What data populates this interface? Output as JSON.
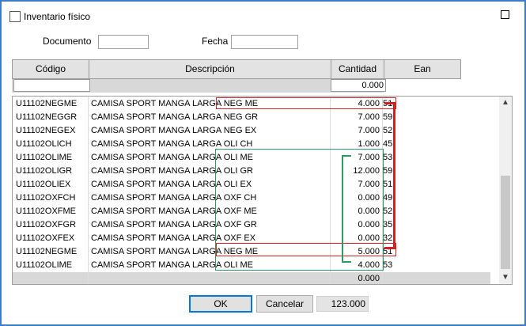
{
  "window": {
    "title": "Inventario físico"
  },
  "form": {
    "documento_label": "Documento",
    "documento_value": "",
    "fecha_label": "Fecha",
    "fecha_value": ""
  },
  "grid": {
    "headers": {
      "codigo": "Código",
      "descripcion": "Descripción",
      "cantidad": "Cantidad",
      "ean": "Ean"
    },
    "filter": {
      "codigo": "",
      "cantidad": "0.000"
    },
    "rows": [
      {
        "codigo": "U11102NEGME",
        "descripcion": "CAMISA SPORT MANGA LARGA NEG ME",
        "cantidad": "4.000",
        "ean": "51"
      },
      {
        "codigo": "U11102NEGGR",
        "descripcion": "CAMISA SPORT MANGA LARGA NEG GR",
        "cantidad": "7.000",
        "ean": "59"
      },
      {
        "codigo": "U11102NEGEX",
        "descripcion": "CAMISA SPORT MANGA LARGA NEG EX",
        "cantidad": "7.000",
        "ean": "52"
      },
      {
        "codigo": "U11102OLICH",
        "descripcion": "CAMISA SPORT MANGA LARGA OLI CH",
        "cantidad": "1.000",
        "ean": "45"
      },
      {
        "codigo": "U11102OLIME",
        "descripcion": "CAMISA SPORT MANGA LARGA OLI ME",
        "cantidad": "7.000",
        "ean": "53"
      },
      {
        "codigo": "U11102OLIGR",
        "descripcion": "CAMISA SPORT MANGA LARGA OLI GR",
        "cantidad": "12.000",
        "ean": "59"
      },
      {
        "codigo": "U11102OLIEX",
        "descripcion": "CAMISA SPORT MANGA LARGA OLI EX",
        "cantidad": "7.000",
        "ean": "51"
      },
      {
        "codigo": "U11102OXFCH",
        "descripcion": "CAMISA SPORT MANGA LARGA OXF CH",
        "cantidad": "0.000",
        "ean": "49"
      },
      {
        "codigo": "U11102OXFME",
        "descripcion": "CAMISA SPORT MANGA LARGA OXF ME",
        "cantidad": "0.000",
        "ean": "52"
      },
      {
        "codigo": "U11102OXFGR",
        "descripcion": "CAMISA SPORT MANGA LARGA OXF GR",
        "cantidad": "0.000",
        "ean": "35"
      },
      {
        "codigo": "U11102OXFEX",
        "descripcion": "CAMISA SPORT MANGA LARGA OXF EX",
        "cantidad": "0.000",
        "ean": "32"
      },
      {
        "codigo": "U11102NEGME",
        "descripcion": "CAMISA SPORT MANGA LARGA NEG ME",
        "cantidad": "5.000",
        "ean": "51"
      },
      {
        "codigo": "U11102OLIME",
        "descripcion": "CAMISA SPORT MANGA LARGA OLI ME",
        "cantidad": "4.000",
        "ean": "53"
      }
    ],
    "total_row": {
      "cantidad": "0.000"
    }
  },
  "buttons": {
    "ok": "OK",
    "cancel": "Cancelar"
  },
  "total": "123.000",
  "colors": {
    "red_highlight": "#d42020",
    "green_highlight": "#2e9a63",
    "accent": "#0078d7"
  }
}
